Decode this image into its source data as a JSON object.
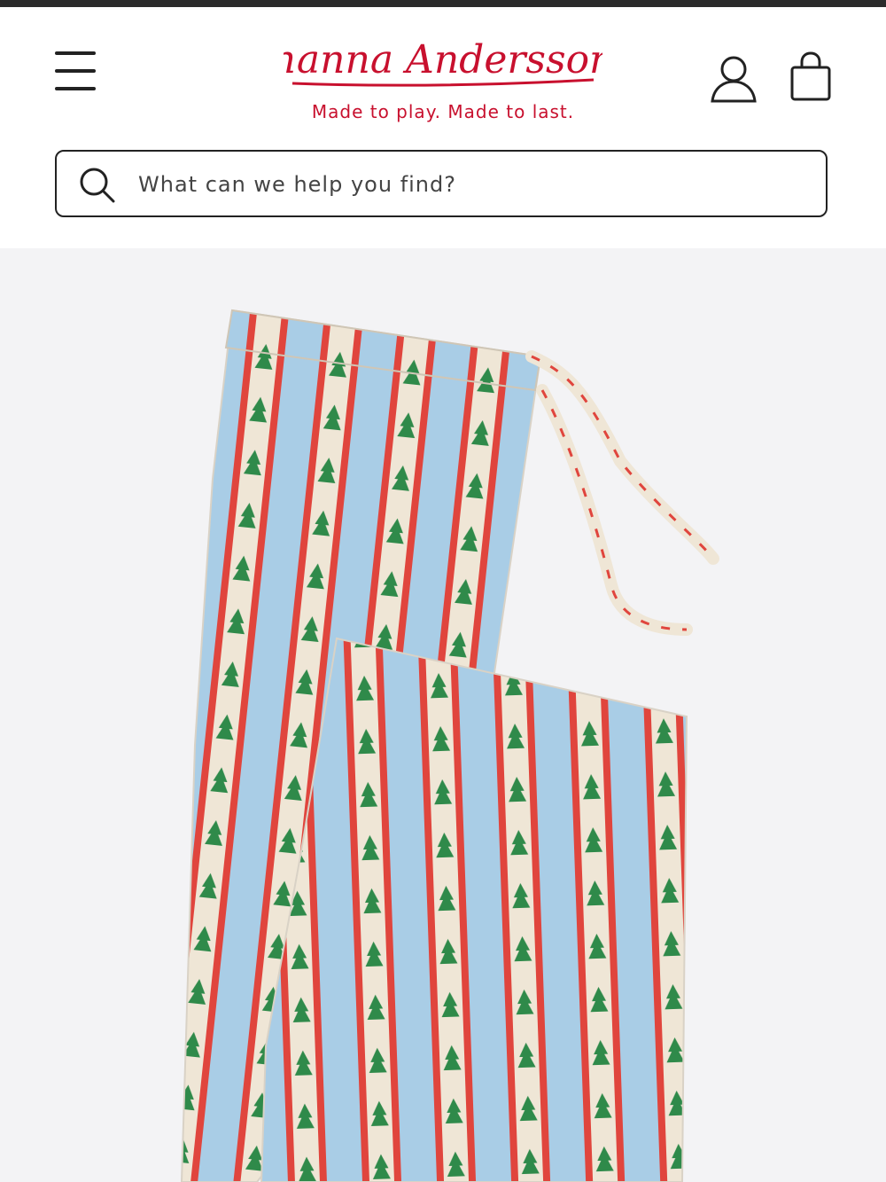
{
  "brand": {
    "name": "hanna Andersson",
    "tagline": "Made to play. Made to last.",
    "color": "#c8102e"
  },
  "header": {
    "menu_icon": "hamburger-menu-icon",
    "account_icon": "user-icon",
    "bag_icon": "shopping-bag-icon"
  },
  "search": {
    "placeholder": "What can we help you find?",
    "value": "",
    "icon": "search-icon"
  },
  "product_image": {
    "alt": "Striped holiday pajama pants with tree print",
    "colors": {
      "blue": "#a9cde6",
      "red": "#e0453d",
      "cream": "#efe6d6",
      "tree": "#2f8a4a"
    }
  }
}
